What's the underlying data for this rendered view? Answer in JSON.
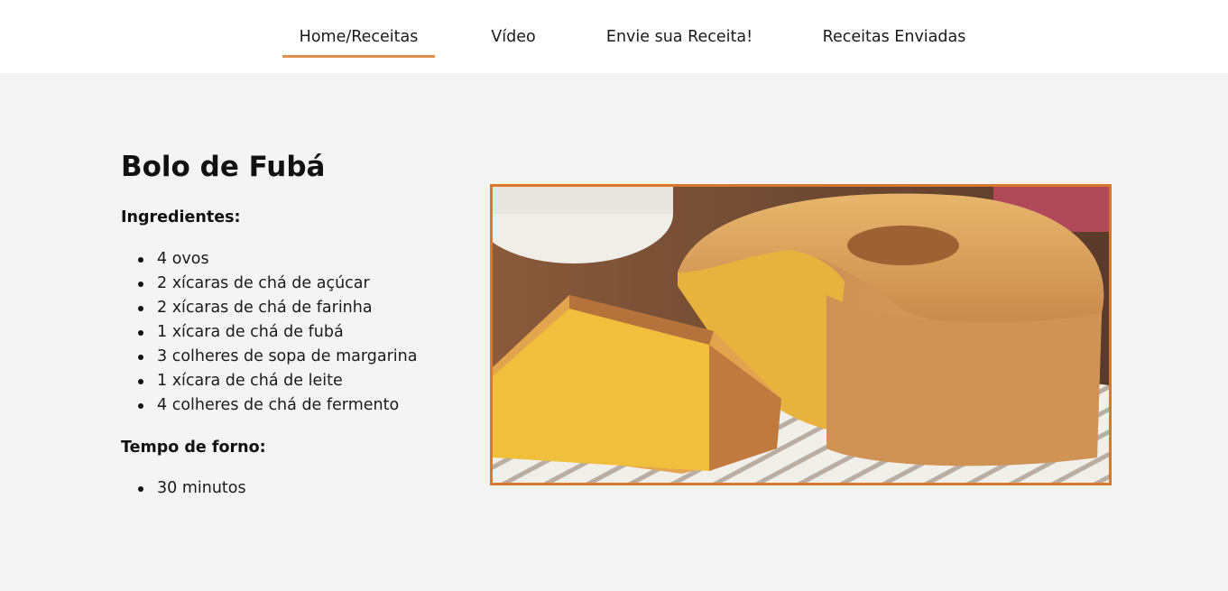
{
  "nav": {
    "items": [
      {
        "label": "Home/Receitas",
        "active": true
      },
      {
        "label": "Vídeo",
        "active": false
      },
      {
        "label": "Envie sua Receita!",
        "active": false
      },
      {
        "label": "Receitas Enviadas",
        "active": false
      }
    ],
    "active_color": "#e0904a"
  },
  "recipe": {
    "title": "Bolo de Fubá",
    "ingredients_title": "Ingredientes:",
    "ingredients": [
      "4 ovos",
      "2 xícaras de chá de açúcar",
      "2 xícaras de chá de farinha",
      "1 xícara de chá de fubá",
      "3 colheres de sopa de margarina",
      "1 xícara de chá de leite",
      "4 colheres de chá de fermento"
    ],
    "bake_title": "Tempo de forno:",
    "bake_items": [
      "30 minutos"
    ]
  },
  "image": {
    "subject": "cornmeal-cake-photo",
    "border_color": "#d9772b"
  }
}
